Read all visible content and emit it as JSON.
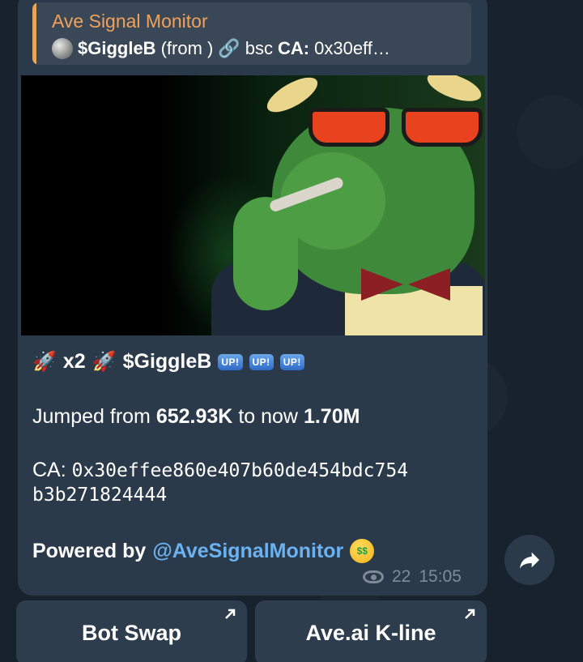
{
  "reply": {
    "title": "Ave Signal Monitor",
    "ticker": "$GiggleB",
    "from": "(from )",
    "chain": "bsc",
    "ca_label": "CA:",
    "ca_short": "0x30eff…"
  },
  "message": {
    "multiplier": "x2",
    "ticker": "$GiggleB",
    "up_badges": [
      "UP!",
      "UP!",
      "UP!"
    ],
    "jump_prefix": "Jumped from ",
    "jump_from": "652.93K",
    "jump_mid": " to now ",
    "jump_to": "1.70M",
    "ca_label": "CA: ",
    "ca_line1": "0x30effee860e407b60de454bdc754",
    "ca_line2": "b3b271824444",
    "powered_by": "Powered by ",
    "mention": "@AveSignalMonitor"
  },
  "meta": {
    "views": "22",
    "time": "15:05"
  },
  "buttons": [
    {
      "label": "Bot Swap"
    },
    {
      "label": "Ave.ai K-line"
    }
  ],
  "icons": {
    "coin": "coin-icon",
    "link": "link-icon",
    "rocket": "rocket-icon",
    "eye": "views-eye-icon",
    "share": "share-arrow-icon",
    "external": "external-link-arrow-icon"
  }
}
